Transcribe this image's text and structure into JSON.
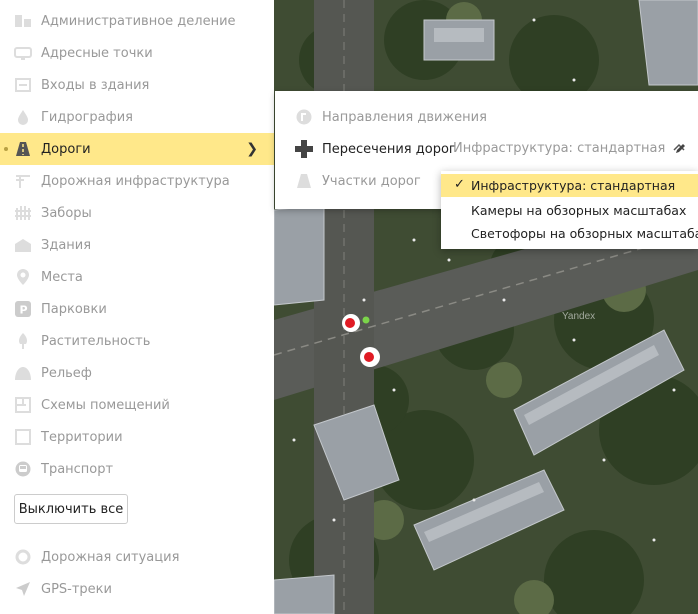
{
  "sidebar": {
    "items": [
      {
        "label": "Административное деление",
        "icon": "admin-division-icon"
      },
      {
        "label": "Адресные точки",
        "icon": "address-points-icon"
      },
      {
        "label": "Входы в здания",
        "icon": "building-entrances-icon"
      },
      {
        "label": "Гидрография",
        "icon": "water-drop-icon"
      },
      {
        "label": "Дороги",
        "icon": "road-icon",
        "active": true
      },
      {
        "label": "Дорожная инфраструктура",
        "icon": "road-infrastructure-icon"
      },
      {
        "label": "Заборы",
        "icon": "fence-icon"
      },
      {
        "label": "Здания",
        "icon": "building-icon"
      },
      {
        "label": "Места",
        "icon": "place-pin-icon"
      },
      {
        "label": "Парковки",
        "icon": "parking-icon"
      },
      {
        "label": "Растительность",
        "icon": "tree-icon"
      },
      {
        "label": "Рельеф",
        "icon": "relief-icon"
      },
      {
        "label": "Схемы помещений",
        "icon": "indoor-plans-icon"
      },
      {
        "label": "Территории",
        "icon": "territory-icon"
      },
      {
        "label": "Транспорт",
        "icon": "transport-icon"
      }
    ],
    "off_all_label": "Выключить все",
    "extra_items": [
      {
        "label": "Дорожная ситуация",
        "icon": "traffic-icon"
      },
      {
        "label": "GPS-треки",
        "icon": "gps-tracks-icon"
      }
    ]
  },
  "roads_panel": {
    "items": [
      {
        "label": "Направления движения",
        "icon": "directions-icon"
      },
      {
        "label": "Пересечения дорог",
        "icon": "intersection-icon"
      },
      {
        "label": "Участки дорог",
        "icon": "road-segments-icon"
      }
    ],
    "infrastructure_selected": "Инфраструктура: стандартная"
  },
  "infrastructure_dropdown": {
    "options": [
      {
        "label": "Инфраструктура: стандартная",
        "selected": true
      },
      {
        "label": "Камеры на обзорных масштабах",
        "selected": false
      },
      {
        "label": "Светофоры на обзорных масштабах",
        "selected": false
      }
    ]
  },
  "map": {
    "watermark": "Yandex"
  },
  "colors": {
    "highlight": "#ffe88a",
    "muted": "#999999",
    "map_base": "#3e4b33"
  }
}
